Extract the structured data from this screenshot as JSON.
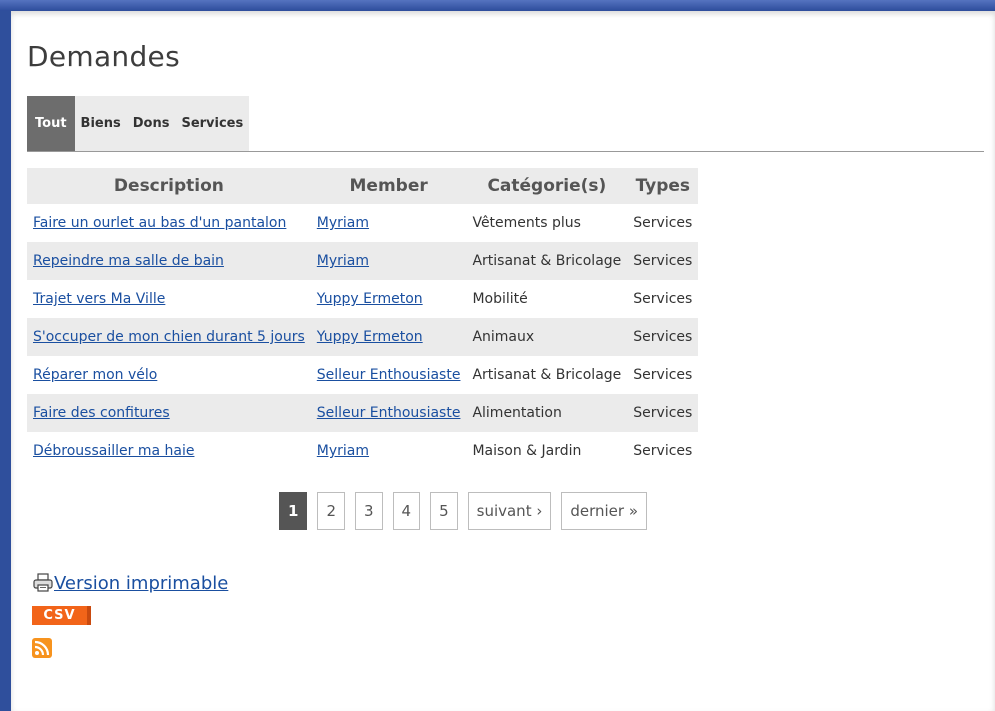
{
  "page": {
    "title": "Demandes"
  },
  "tabs": [
    {
      "label": "Tout",
      "active": true
    },
    {
      "label": "Biens",
      "active": false
    },
    {
      "label": "Dons",
      "active": false
    },
    {
      "label": "Services",
      "active": false
    }
  ],
  "table": {
    "headers": [
      "Description",
      "Member",
      "Catégorie(s)",
      "Types"
    ],
    "rows": [
      {
        "description": "Faire un ourlet au bas d'un pantalon",
        "member": "Myriam",
        "category": "Vêtements plus",
        "type": "Services"
      },
      {
        "description": "Repeindre ma salle de bain",
        "member": "Myriam",
        "category": "Artisanat & Bricolage",
        "type": "Services"
      },
      {
        "description": "Trajet vers Ma Ville",
        "member": "Yuppy Ermeton",
        "category": "Mobilité",
        "type": "Services"
      },
      {
        "description": "S'occuper de mon chien durant 5 jours",
        "member": "Yuppy Ermeton",
        "category": "Animaux",
        "type": "Services"
      },
      {
        "description": "Réparer mon vélo",
        "member": "Selleur Enthousiaste",
        "category": "Artisanat & Bricolage",
        "type": "Services"
      },
      {
        "description": "Faire des confitures",
        "member": "Selleur Enthousiaste",
        "category": "Alimentation",
        "type": "Services"
      },
      {
        "description": "Débroussailler ma haie",
        "member": "Myriam",
        "category": "Maison & Jardin",
        "type": "Services"
      }
    ]
  },
  "pager": {
    "pages": [
      "1",
      "2",
      "3",
      "4",
      "5"
    ],
    "current": "1",
    "next_label": "suivant ›",
    "last_label": "dernier »"
  },
  "footer": {
    "print_label": "Version imprimable",
    "csv_label": "CSV"
  },
  "colors": {
    "accent": "#2f4f9c",
    "link": "#1a4fa0",
    "csv": "#f26419",
    "rss": "#f7931e"
  }
}
